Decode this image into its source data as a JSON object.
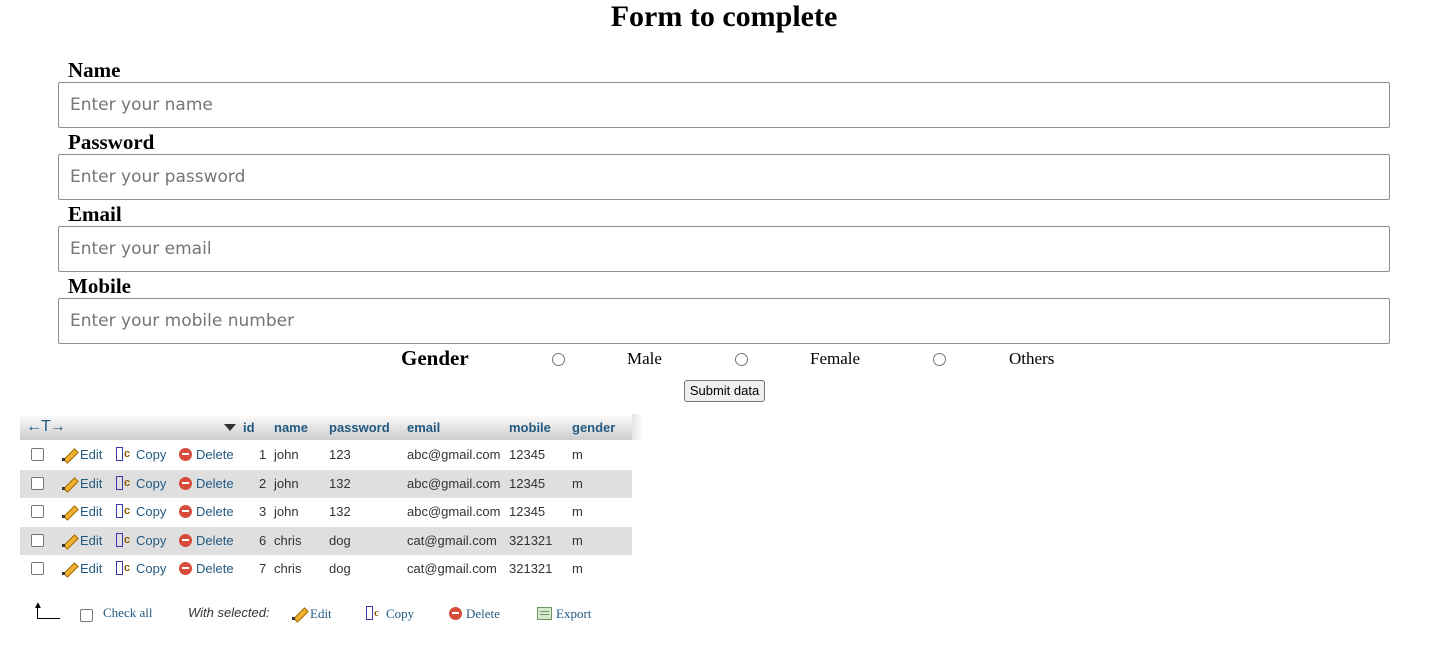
{
  "form": {
    "title": "Form to complete",
    "fields": [
      {
        "label": "Name",
        "placeholder": "Enter your name"
      },
      {
        "label": "Password",
        "placeholder": "Enter your password"
      },
      {
        "label": "Email",
        "placeholder": "Enter your email"
      },
      {
        "label": "Mobile",
        "placeholder": "Enter your mobile number"
      }
    ],
    "gender": {
      "label": "Gender",
      "options": [
        "Male",
        "Female",
        "Others"
      ]
    },
    "submit_label": "Submit data"
  },
  "table": {
    "nav_arrows": "←T→",
    "columns": [
      "id",
      "name",
      "password",
      "email",
      "mobile",
      "gender"
    ],
    "actions": {
      "edit": "Edit",
      "copy": "Copy",
      "delete": "Delete"
    },
    "rows": [
      {
        "id": "1",
        "name": "john",
        "password": "123",
        "email": "abc@gmail.com",
        "mobile": "12345",
        "gender": "m"
      },
      {
        "id": "2",
        "name": "john",
        "password": "132",
        "email": "abc@gmail.com",
        "mobile": "12345",
        "gender": "m"
      },
      {
        "id": "3",
        "name": "john",
        "password": "132",
        "email": "abc@gmail.com",
        "mobile": "12345",
        "gender": "m"
      },
      {
        "id": "6",
        "name": "chris",
        "password": "dog",
        "email": "cat@gmail.com",
        "mobile": "321321",
        "gender": "m"
      },
      {
        "id": "7",
        "name": "chris",
        "password": "dog",
        "email": "cat@gmail.com",
        "mobile": "321321",
        "gender": "m"
      }
    ]
  },
  "footer": {
    "check_all": "Check all",
    "with_selected": "With selected:",
    "edit": "Edit",
    "copy": "Copy",
    "delete": "Delete",
    "export": "Export"
  },
  "colors": {
    "link": "#235a81",
    "row_alt": "#dfdfdf"
  }
}
